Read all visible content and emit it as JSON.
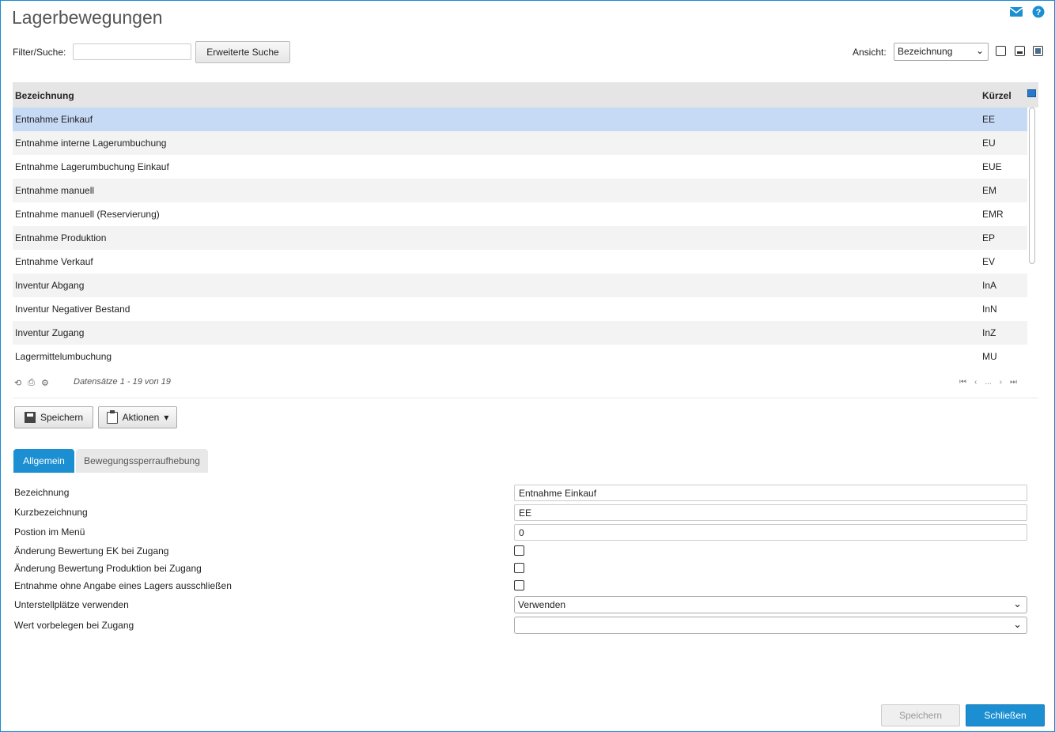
{
  "page": {
    "title": "Lagerbewegungen"
  },
  "icons": {
    "mail": "mail-icon",
    "help": "help-icon"
  },
  "filter": {
    "label": "Filter/Suche:",
    "value": "",
    "advanced_button": "Erweiterte Suche"
  },
  "view": {
    "label": "Ansicht:",
    "selected": "Bezeichnung"
  },
  "grid": {
    "columns": [
      "Bezeichnung",
      "Kürzel"
    ],
    "rows": [
      {
        "name": "Entnahme Einkauf",
        "code": "EE"
      },
      {
        "name": "Entnahme interne Lagerumbuchung",
        "code": "EU"
      },
      {
        "name": "Entnahme Lagerumbuchung Einkauf",
        "code": "EUE"
      },
      {
        "name": "Entnahme manuell",
        "code": "EM"
      },
      {
        "name": "Entnahme manuell (Reservierung)",
        "code": "EMR"
      },
      {
        "name": "Entnahme Produktion",
        "code": "EP"
      },
      {
        "name": "Entnahme Verkauf",
        "code": "EV"
      },
      {
        "name": "Inventur Abgang",
        "code": "InA"
      },
      {
        "name": "Inventur Negativer Bestand",
        "code": "InN"
      },
      {
        "name": "Inventur Zugang",
        "code": "InZ"
      },
      {
        "name": "Lagermittelumbuchung",
        "code": "MU"
      }
    ],
    "selected_index": 0,
    "records_text": "Datensätze 1 - 19 von 19",
    "pager_dots": "..."
  },
  "toolbar": {
    "save_label": "Speichern",
    "actions_label": "Aktionen"
  },
  "tabs": [
    "Allgemein",
    "Bewegungssperraufhebung"
  ],
  "form": {
    "bezeichnung_label": "Bezeichnung",
    "bezeichnung_value": "Entnahme Einkauf",
    "kurz_label": "Kurzbezeichnung",
    "kurz_value": "EE",
    "position_label": "Postion im Menü",
    "position_value": "0",
    "ek_label": "Änderung Bewertung EK bei Zugang",
    "ek_checked": false,
    "prod_label": "Änderung Bewertung Produktion bei Zugang",
    "prod_checked": false,
    "lager_label": "Entnahme ohne Angabe eines Lagers ausschließen",
    "lager_checked": false,
    "unter_label": "Unterstellplätze verwenden",
    "unter_value": "Verwenden",
    "wert_label": "Wert vorbelegen bei Zugang",
    "wert_value": ""
  },
  "footer": {
    "save_label": "Speichern",
    "close_label": "Schließen"
  }
}
